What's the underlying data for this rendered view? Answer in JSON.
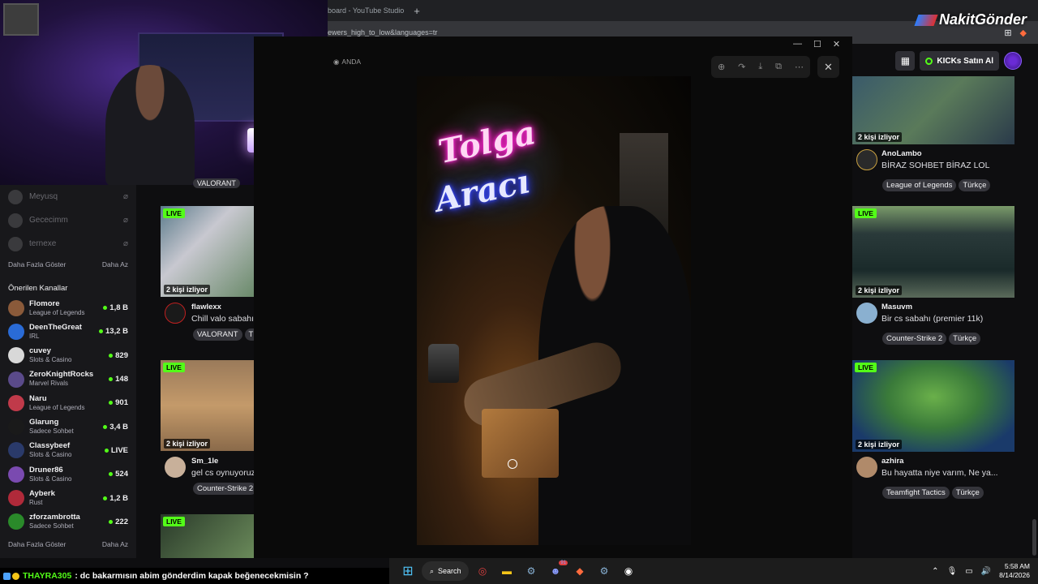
{
  "browser": {
    "tab_title": "board - YouTube Studio",
    "new_tab": "+",
    "url": "iewers_high_to_low&languages=tr"
  },
  "brand": {
    "name": "NakitGönder"
  },
  "kick_header": {
    "kicks_label": "KICKs Satın Al"
  },
  "sidebar": {
    "followed": [
      {
        "name": "Meyusq"
      },
      {
        "name": "Gececimm"
      },
      {
        "name": "ternexe"
      }
    ],
    "show_more": "Daha Fazla Göster",
    "show_less": "Daha Az",
    "recommended_title": "Önerilen Kanallar",
    "recommended": [
      {
        "name": "Flomore",
        "category": "League of Legends",
        "viewers": "1,8 B",
        "color": "#8a5a3a"
      },
      {
        "name": "DeenTheGreat",
        "category": "IRL",
        "viewers": "13,2 B",
        "color": "#2a6bd6"
      },
      {
        "name": "cuvey",
        "category": "Slots & Casino",
        "viewers": "829",
        "color": "#d8d8d8"
      },
      {
        "name": "ZeroKnightRocks",
        "category": "Marvel Rivals",
        "viewers": "148",
        "color": "#5a4a8a"
      },
      {
        "name": "Naru",
        "category": "League of Legends",
        "viewers": "901",
        "color": "#c03a4a"
      },
      {
        "name": "Glarung",
        "category": "Sadece Sohbet",
        "viewers": "3,4 B",
        "color": "#1a1a1a"
      },
      {
        "name": "Classybeef",
        "category": "Slots & Casino",
        "viewers": "LIVE",
        "color": "#2a3a6a"
      },
      {
        "name": "Druner86",
        "category": "Slots & Casino",
        "viewers": "524",
        "color": "#7a4ab0"
      },
      {
        "name": "Ayberk",
        "category": "Rust",
        "viewers": "1,2 B",
        "color": "#b02a3a"
      },
      {
        "name": "zforzambrotta",
        "category": "Sadece Sohbet",
        "viewers": "222",
        "color": "#2a8a2a"
      }
    ],
    "footer_more": "Daha Fazla Göster",
    "footer_less": "Daha Az"
  },
  "middle_cards": [
    {
      "live": "LIVE",
      "viewers": "2 kişi izliyor",
      "name": "flawlexx",
      "title": "Chill valo sabahı",
      "tags": [
        "VALORANT",
        "Türkçe"
      ]
    },
    {
      "live": "LIVE",
      "viewers": "2 kişi izliyor",
      "name": "Sm_1le",
      "title": "gel cs oynuyoruz",
      "tags": [
        "Counter-Strike 2"
      ]
    },
    {
      "live": "LIVE"
    }
  ],
  "middle_top_tag": "VALORANT",
  "viewer": {
    "anda": "ANDA",
    "neon_line1": "Tolga",
    "neon_line2": "Aracı"
  },
  "right_cards": [
    {
      "viewers": "2 kişi izliyor",
      "name": "AnoLambo",
      "title": "BİRAZ SOHBET BİRAZ LOL",
      "tags": [
        "League of Legends",
        "Türkçe"
      ]
    },
    {
      "live": "LIVE",
      "viewers": "2 kişi izliyor",
      "name": "Masuvm",
      "title": "Bir cs sabahı (premier 11k)",
      "tags": [
        "Counter-Strike 2",
        "Türkçe"
      ]
    },
    {
      "live": "LIVE",
      "viewers": "2 kişi izliyor",
      "name": "azhira",
      "title": "Bu hayatta niye varım, Ne ya...",
      "tags": [
        "Teamfight Tactics",
        "Türkçe"
      ]
    }
  ],
  "chat": {
    "username": "THAYRA305",
    "message": ": dc bakarmısın abim gönderdim kapak beğenecekmisin ?"
  },
  "taskbar": {
    "search_label": "Search",
    "time": "5:58 AM",
    "date": "8/14/2026",
    "discord_badge": "91"
  }
}
